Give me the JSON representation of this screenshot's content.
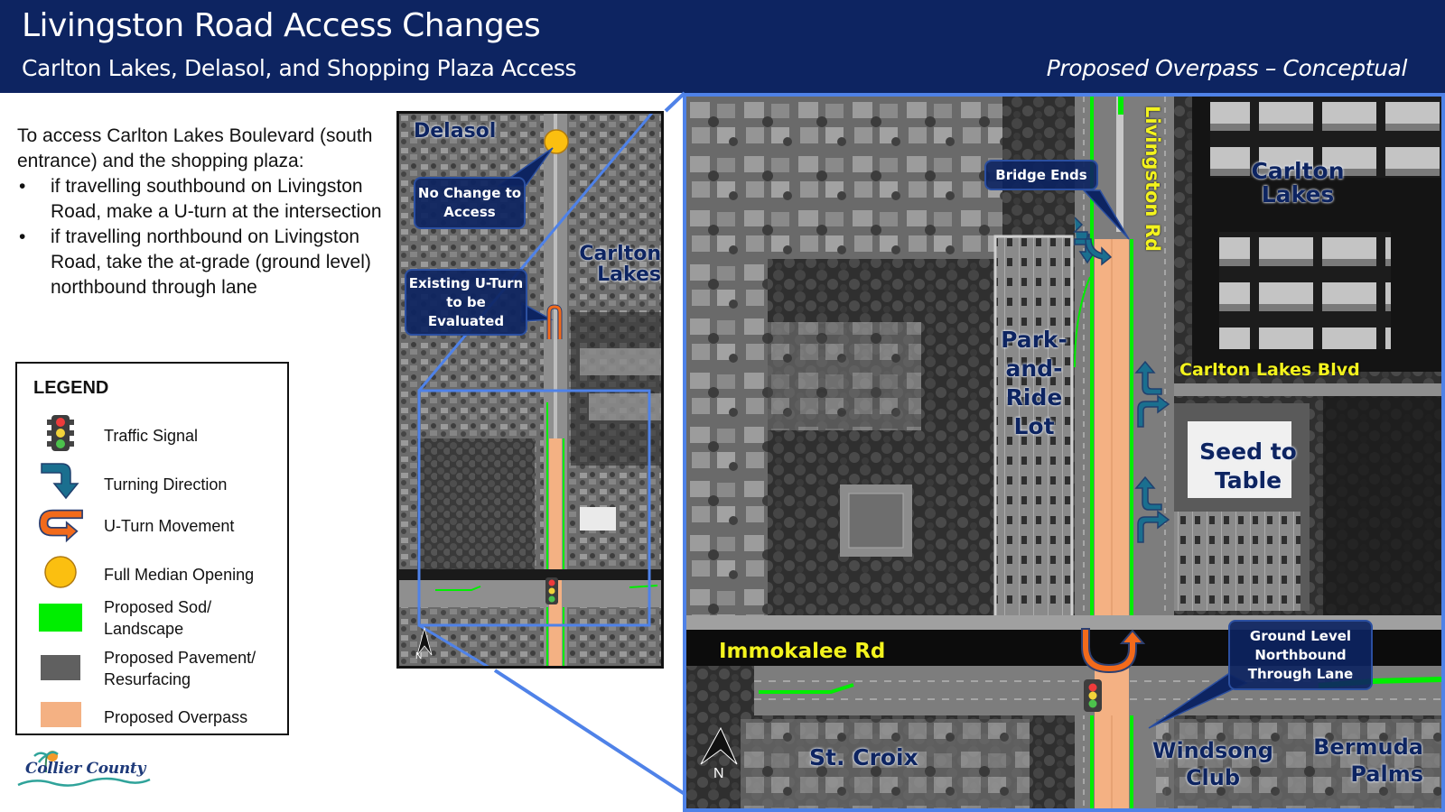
{
  "header": {
    "title": "Livingston Road Access Changes",
    "subtitle": "Carlton Lakes, Delasol, and Shopping Plaza Access",
    "status": "Proposed Overpass – Conceptual"
  },
  "instructions": {
    "intro": "To access Carlton Lakes Boulevard (south entrance) and the shopping plaza:",
    "bullets": [
      "if travelling southbound on Livingston Road, make a U-turn at the intersection",
      "if travelling northbound on Livingston Road, take the at-grade (ground level) northbound through lane"
    ]
  },
  "legend": {
    "title": "LEGEND",
    "items": [
      {
        "icon": "traffic-signal-icon",
        "label": "Traffic Signal"
      },
      {
        "icon": "turning-direction-icon",
        "label": "Turning Direction"
      },
      {
        "icon": "u-turn-icon",
        "label": "U-Turn Movement"
      },
      {
        "icon": "median-opening-icon",
        "label": "Full Median Opening"
      },
      {
        "icon": "sod-swatch",
        "label": "Proposed Sod/ Landscape",
        "color": "#00ee00"
      },
      {
        "icon": "pavement-swatch",
        "label": "Proposed Pavement/ Resurfacing",
        "color": "#606060"
      },
      {
        "icon": "overpass-swatch",
        "label": "Proposed Overpass",
        "color": "#f4b183"
      }
    ]
  },
  "logo": {
    "text": "Collier County"
  },
  "inset_map": {
    "labels": {
      "delasol": "Delasol",
      "carlton_lakes": "Carlton Lakes"
    },
    "callouts": {
      "no_change": "No Change to Access",
      "existing_uturn": "Existing U-Turn to be Evaluated"
    },
    "north": "N"
  },
  "main_map": {
    "road_labels": {
      "livingston": "Livingston Rd",
      "carlton_blvd": "Carlton Lakes Blvd",
      "immokalee": "Immokalee Rd"
    },
    "place_labels": {
      "carlton_lakes": "Carlton Lakes",
      "park_and_ride": "Park- and- Ride Lot",
      "seed_to_table": "Seed to Table",
      "st_croix": "St. Croix",
      "windsong": "Windsong Club",
      "bermuda": "Bermuda Palms"
    },
    "callouts": {
      "bridge_ends": "Bridge Ends",
      "ground_level": "Ground Level Northbound Through Lane"
    },
    "north": "N"
  },
  "colors": {
    "header_bg": "#0d2461",
    "frame_blue": "#4f82e8",
    "sod": "#00ee00",
    "overpass": "#f4b183",
    "turn_arrow": "#1a6f8f",
    "uturn": "#f26a1b",
    "median_opening": "#fbbf10",
    "road_label": "#f3f31e"
  }
}
